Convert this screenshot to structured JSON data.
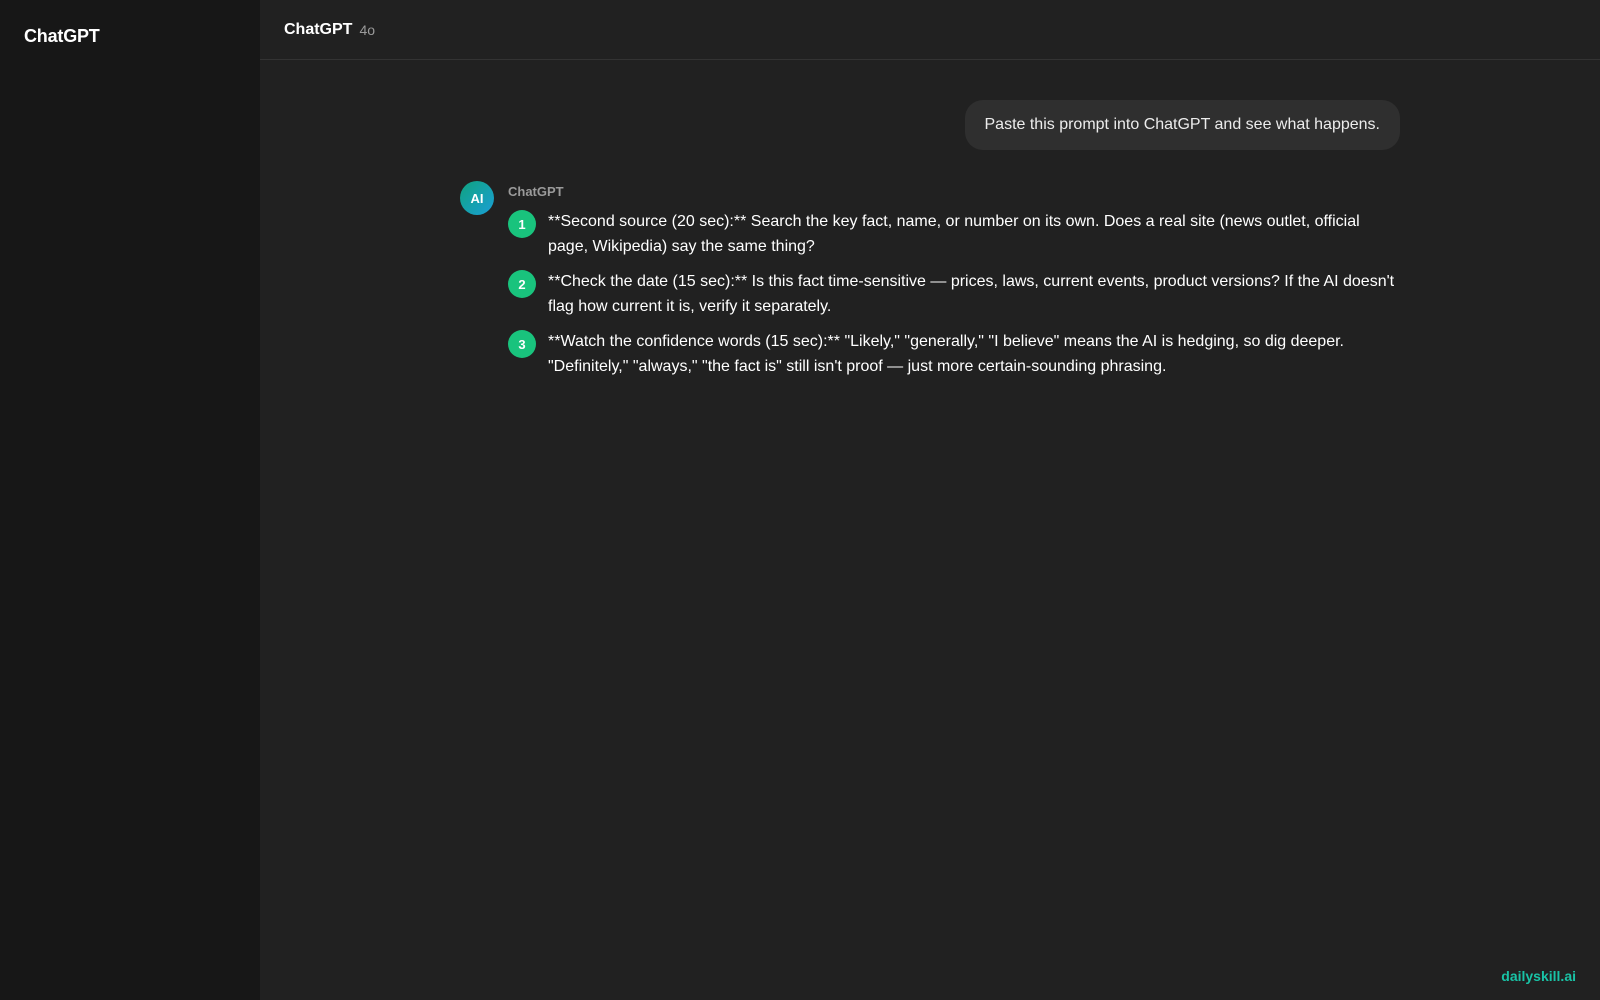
{
  "sidebar": {
    "title": "ChatGPT"
  },
  "header": {
    "title": "ChatGPT",
    "model": "4o"
  },
  "conversation": {
    "user_message": "Paste this prompt into ChatGPT and see what happens.",
    "assistant": {
      "avatar_label": "AI",
      "name": "ChatGPT",
      "steps": [
        {
          "number": "1",
          "text": "**Second source (20 sec):** Search the key fact, name, or number on its own. Does a real site (news outlet, official page, Wikipedia) say the same thing?"
        },
        {
          "number": "2",
          "text": "**Check the date (15 sec):** Is this fact time-sensitive — prices, laws, current events, product versions? If the AI doesn't flag how current it is, verify it separately."
        },
        {
          "number": "3",
          "text": "**Watch the confidence words (15 sec):** \"Likely,\" \"generally,\" \"I believe\" means the AI is hedging, so dig deeper. \"Definitely,\" \"always,\" \"the fact is\" still isn't proof — just more certain-sounding phrasing."
        }
      ]
    }
  },
  "watermark": "dailyskill.ai",
  "colors": {
    "background": "#212121",
    "sidebar": "#171717",
    "step_badge": "#19c37d",
    "watermark": "#19c3a6"
  }
}
